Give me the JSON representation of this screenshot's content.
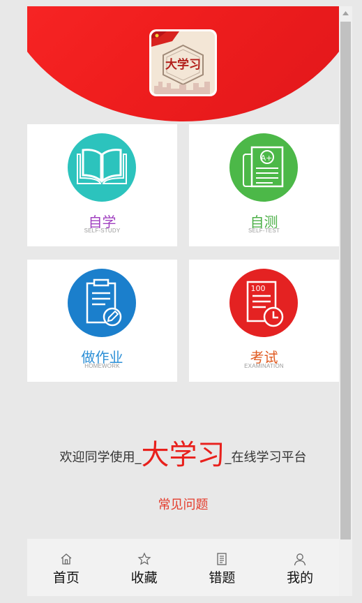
{
  "logo": {
    "text": "大学习"
  },
  "cards": [
    {
      "title": "自学",
      "subtitle": "SELF-STUDY",
      "color": "#a040c0",
      "circle": "#2cc3bd",
      "icon": "book-icon"
    },
    {
      "title": "自测",
      "subtitle": "SELF-TEST",
      "color": "#4cb048",
      "circle": "#4cb848",
      "icon": "test-paper-icon",
      "badge": "A+"
    },
    {
      "title": "做作业",
      "subtitle": "HOMEWORK",
      "color": "#2c8fd6",
      "circle": "#1b7fcc",
      "icon": "clipboard-pen-icon"
    },
    {
      "title": "考试",
      "subtitle": "EXAMINATION",
      "color": "#e05a20",
      "circle": "#e42222",
      "icon": "exam-clock-icon",
      "score": "100"
    }
  ],
  "welcome": {
    "prefix": "欢迎同学使用_",
    "brand": "大学习",
    "suffix": "_在线学习平台"
  },
  "faq": {
    "label": "常见问题"
  },
  "tabs": [
    {
      "label": "首页",
      "icon": "home-icon"
    },
    {
      "label": "收藏",
      "icon": "star-icon"
    },
    {
      "label": "错题",
      "icon": "document-icon"
    },
    {
      "label": "我的",
      "icon": "user-icon"
    }
  ]
}
